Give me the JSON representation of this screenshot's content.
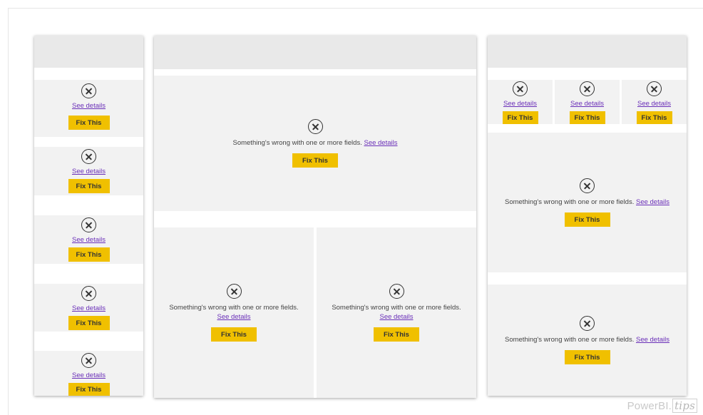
{
  "visual_error": {
    "icon": "error-x-circle-icon",
    "message": "Something's wrong with one or more fields.",
    "details_link": "See details",
    "fix_button": "Fix This"
  },
  "colors": {
    "fix_button": "#f0c000",
    "link": "#6a2fb8",
    "visual_background": "#f2f2f2",
    "frame_header": "#e9e9e9"
  },
  "watermark": {
    "brand": "PowerBI.",
    "suffix": "tips"
  }
}
